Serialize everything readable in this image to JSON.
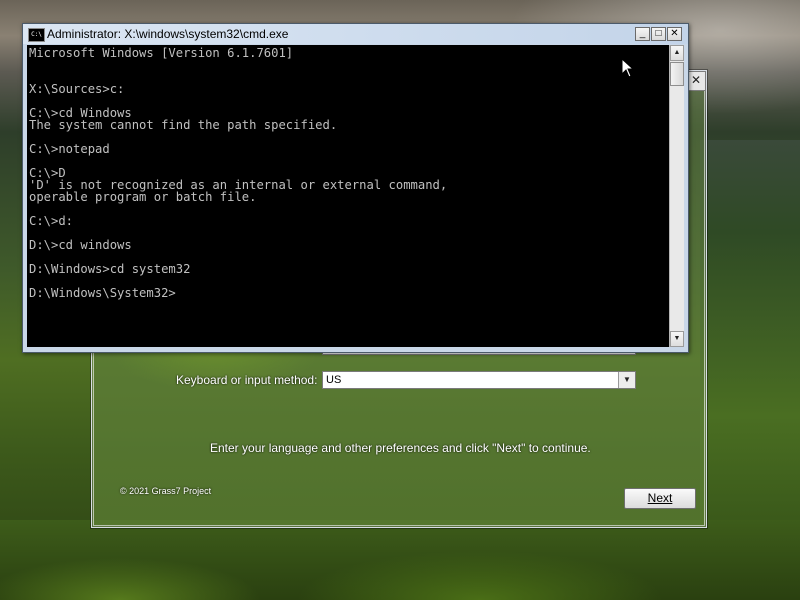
{
  "cmd_window": {
    "title": "Administrator: X:\\windows\\system32\\cmd.exe",
    "icon_text": "C:\\",
    "minimize_glyph": "_",
    "maximize_glyph": "□",
    "close_glyph": "✕",
    "console_lines": [
      "Microsoft Windows [Version 6.1.7601]",
      "",
      "",
      "X:\\Sources>c:",
      "",
      "C:\\>cd Windows",
      "The system cannot find the path specified.",
      "",
      "C:\\>notepad",
      "",
      "C:\\>D",
      "'D' is not recognized as an internal or external command,",
      "operable program or batch file.",
      "",
      "C:\\>d:",
      "",
      "D:\\>cd windows",
      "",
      "D:\\Windows>cd system32",
      "",
      "D:\\Windows\\System32>"
    ],
    "scroll_up_glyph": "▲",
    "scroll_down_glyph": "▼"
  },
  "setup_dialog": {
    "close_glyph": "✕",
    "keyboard_label": "Keyboard or input method:",
    "keyboard_value": "US",
    "dropdown_glyph": "▼",
    "instruction": "Enter your language and other preferences and click \"Next\" to continue.",
    "copyright": "© 2021 Grass7 Project",
    "next_button": "Next"
  },
  "icons": {
    "cmd_icon": "console-icon",
    "mouse": "arrow-cursor-icon"
  }
}
